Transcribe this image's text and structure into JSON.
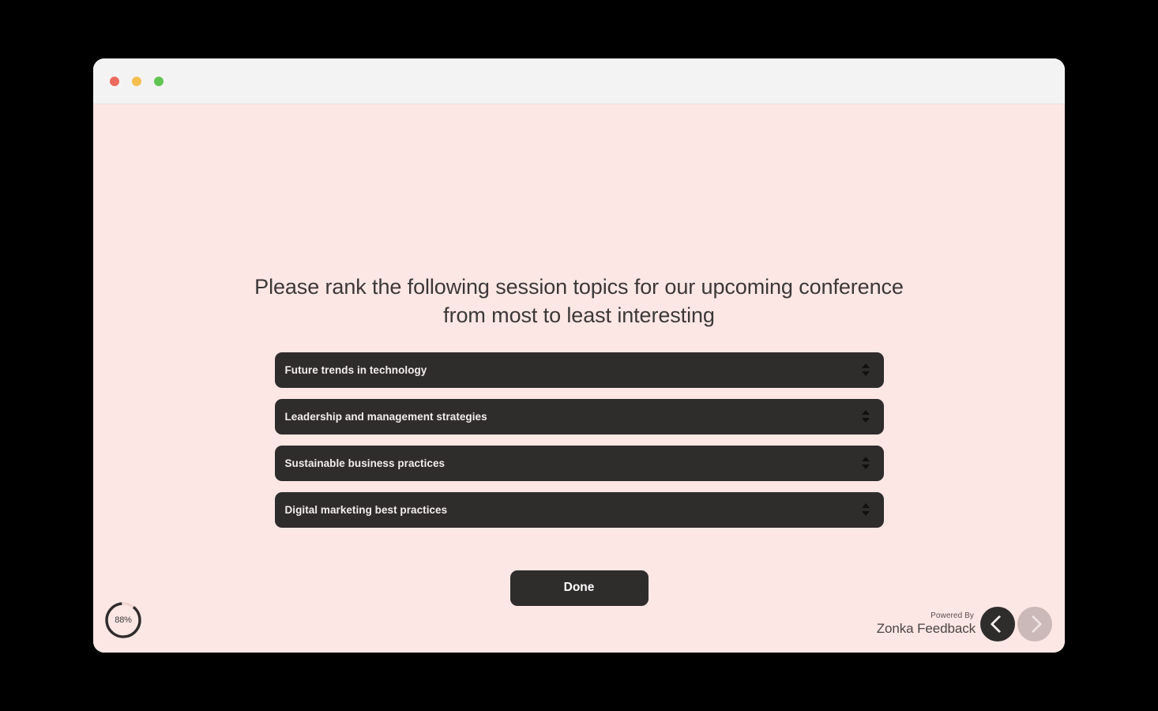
{
  "window": {
    "traffic_lights": [
      {
        "name": "close",
        "color": "#ec6a5e"
      },
      {
        "name": "minimize",
        "color": "#f4bf4f"
      },
      {
        "name": "maximize",
        "color": "#61c554"
      }
    ]
  },
  "survey": {
    "background_color": "#fde7e4",
    "question": "Please rank the following session topics for our upcoming conference from most to least interesting",
    "items": [
      {
        "label": "Future trends in technology",
        "rank": 1,
        "spinner_icon": "up-down-arrows-icon"
      },
      {
        "label": "Leadership and management strategies",
        "rank": 2,
        "spinner_icon": "up-down-arrows-icon"
      },
      {
        "label": "Sustainable business practices",
        "rank": 3,
        "spinner_icon": "up-down-arrows-icon"
      },
      {
        "label": "Digital marketing best practices",
        "rank": 4,
        "spinner_icon": "up-down-arrows-icon"
      }
    ],
    "submit_label": "Done",
    "item_color": "#2f2c2c"
  },
  "progress": {
    "label": "88%",
    "percent": 88,
    "track_color": "#f3d4d1",
    "bar_color": "#2f2c2c"
  },
  "footer": {
    "powered_by": "Powered By",
    "brand": "Zonka Feedback",
    "prev_label": "chevron-left-icon",
    "next_label": "chevron-right-icon",
    "prev_color": "#2f2c2c",
    "next_color": "#cbb9b9"
  }
}
